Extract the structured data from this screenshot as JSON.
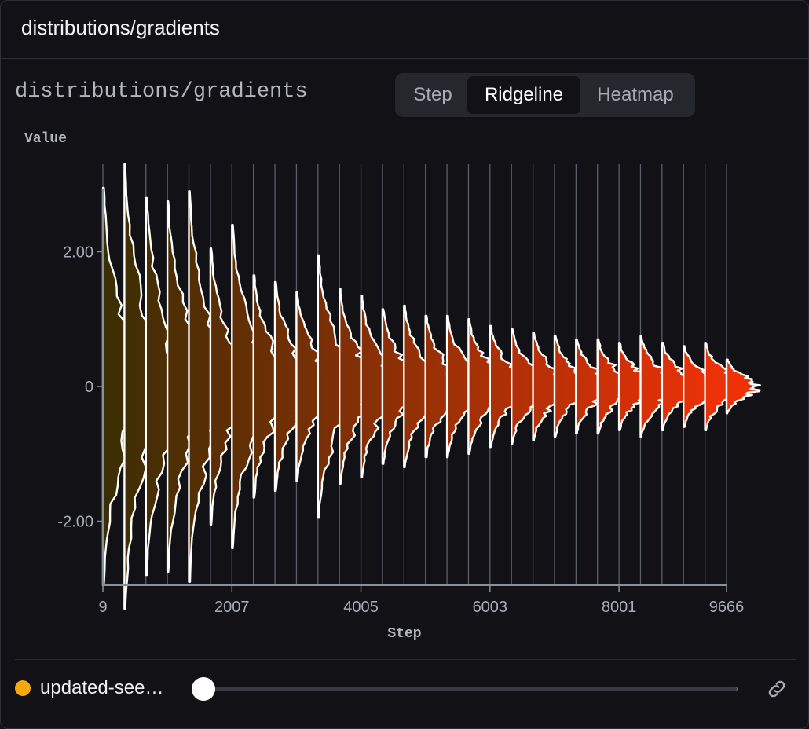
{
  "panel": {
    "title": "distributions/gradients"
  },
  "chart_title": "distributions/gradients",
  "view_tabs": [
    {
      "label": "Step",
      "active": false
    },
    {
      "label": "Ridgeline",
      "active": true
    },
    {
      "label": "Heatmap",
      "active": false
    }
  ],
  "footer": {
    "run_name": "updated-see…",
    "run_color": "#f6a90e",
    "slider_value": 0,
    "link_icon": "link-icon"
  },
  "chart_data": {
    "type": "ridgeline",
    "xlabel": "Step",
    "ylabel": "Value",
    "x_ticks": [
      "9",
      "2007",
      "4005",
      "6003",
      "8001",
      "9666"
    ],
    "xlim": [
      9,
      9666
    ],
    "y_ticks": [
      {
        "value": 2,
        "label": "2.00"
      },
      {
        "value": 0,
        "label": "0"
      },
      {
        "value": -2,
        "label": "-2.00"
      }
    ],
    "ylim": [
      -2.95,
      3.3
    ],
    "color_start": "#3a2e04",
    "color_end": "#ef3108",
    "steps": [
      9,
      342,
      675,
      1008,
      1341,
      1674,
      2007,
      2340,
      2673,
      3006,
      3339,
      3672,
      4005,
      4338,
      4671,
      5004,
      5337,
      5670,
      6003,
      6336,
      6669,
      7002,
      7335,
      7668,
      8001,
      8334,
      8667,
      9000,
      9333,
      9666
    ],
    "value_spread_max": [
      2.95,
      3.3,
      2.8,
      2.75,
      2.9,
      2.05,
      2.4,
      1.65,
      1.55,
      1.4,
      1.95,
      1.45,
      1.35,
      1.15,
      1.2,
      1.05,
      1.05,
      1.0,
      0.9,
      0.85,
      0.8,
      0.75,
      0.7,
      0.7,
      0.65,
      0.75,
      0.65,
      0.6,
      0.65,
      0.4
    ]
  }
}
